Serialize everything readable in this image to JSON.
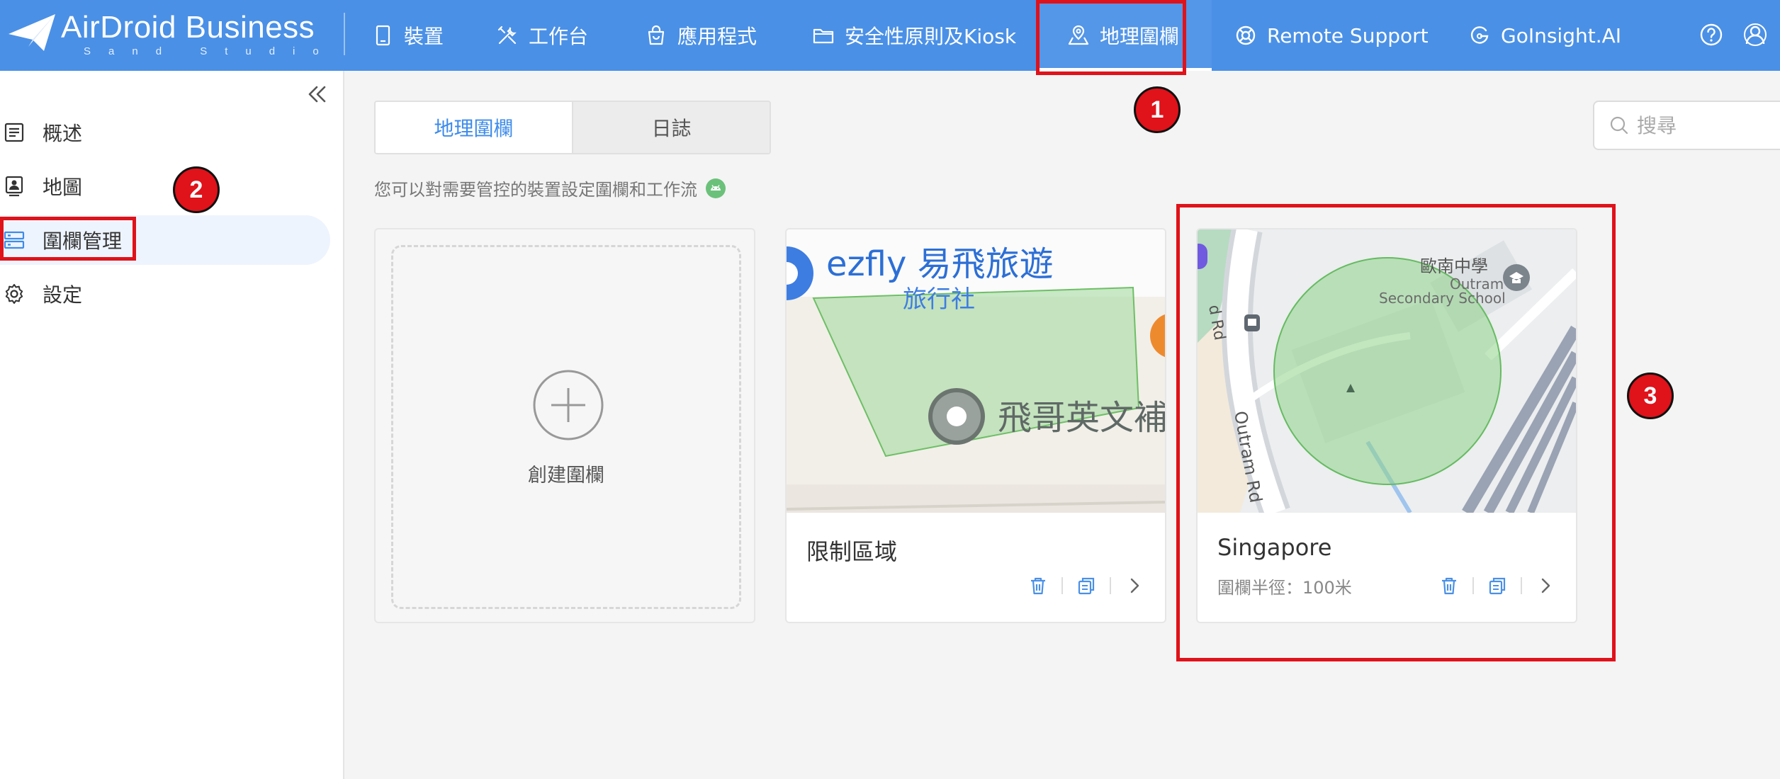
{
  "brand": {
    "name": "AirDroid Business",
    "sub": "Sand Studio"
  },
  "nav": [
    {
      "label": "裝置",
      "icon": "device-icon"
    },
    {
      "label": "工作台",
      "icon": "tools-icon"
    },
    {
      "label": "應用程式",
      "icon": "app-bag-icon"
    },
    {
      "label": "安全性原則及Kiosk",
      "icon": "folder-icon"
    },
    {
      "label": "地理圍欄",
      "icon": "geofence-map-icon"
    },
    {
      "label": "Remote Support",
      "icon": "lifebuoy-icon"
    },
    {
      "label": "GoInsight.AI",
      "icon": "goinsight-icon"
    }
  ],
  "top_icons": [
    "help-icon",
    "user-icon"
  ],
  "sidebar": {
    "items": [
      {
        "label": "概述",
        "icon": "overview-icon"
      },
      {
        "label": "地圖",
        "icon": "map-icon"
      },
      {
        "label": "圍欄管理",
        "icon": "fence-list-icon"
      },
      {
        "label": "設定",
        "icon": "settings-gear-icon"
      }
    ]
  },
  "tabs": [
    {
      "label": "地理圍欄"
    },
    {
      "label": "日誌"
    }
  ],
  "search": {
    "placeholder": "搜尋"
  },
  "description": "您可以對需要管控的裝置設定圍欄和工作流",
  "create_card": {
    "label": "創建圍欄"
  },
  "cards": [
    {
      "title": "限制區域",
      "map_labels": {
        "main": "ezfly 易飛旅遊",
        "sub": "旅行社",
        "poi": "飛哥英文補"
      }
    },
    {
      "title": "Singapore",
      "subtitle": "圍欄半徑：100米",
      "map_labels": {
        "school_cn": "歐南中學",
        "school_en1": "Outram",
        "school_en2": "Secondary School",
        "road1": "Outram Rd",
        "road2": "d Rd"
      }
    }
  ],
  "annotations": [
    "1",
    "2",
    "3"
  ],
  "colors": {
    "topbar": "#4a90e6",
    "accent": "#3d8bea",
    "highlight": "#e0121a",
    "geofence_fill": "#8fd38a"
  }
}
